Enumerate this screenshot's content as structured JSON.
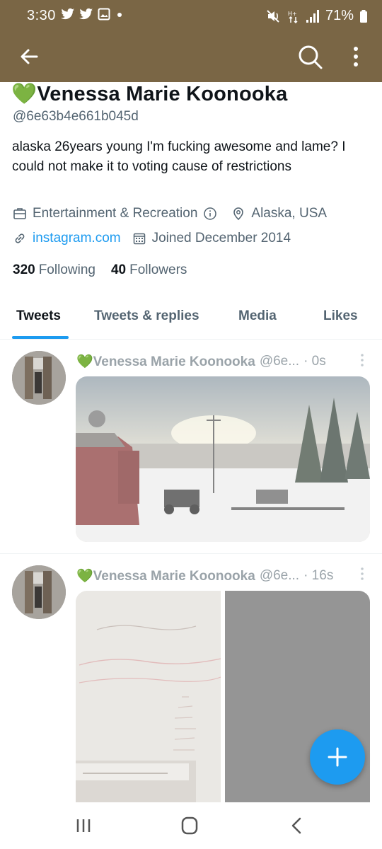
{
  "status_bar": {
    "time": "3:30",
    "battery": "71%",
    "icons_left": [
      "twitter-icon",
      "twitter-icon",
      "gallery-icon",
      "dot-icon"
    ],
    "icons_right": [
      "mute-icon",
      "data-arrows-icon",
      "signal-icon",
      "battery-icon"
    ]
  },
  "app_bar": {
    "icons": [
      "back-arrow-icon",
      "search-icon",
      "more-vertical-icon"
    ],
    "background": "#7a6645"
  },
  "profile": {
    "name_emoji": "💚",
    "name": "Venessa Marie Koonooka",
    "handle": "@6e63b4e661b045d",
    "bio": "alaska 26years young I'm fucking awesome and lame? I could not make it to voting cause of restrictions",
    "category": "Entertainment & Recreation",
    "location": "Alaska, USA",
    "website": "instagram.com",
    "joined": "Joined December 2014",
    "following_count": "320",
    "following_label": "Following",
    "followers_count": "40",
    "followers_label": "Followers"
  },
  "tabs": [
    {
      "label": "Tweets",
      "active": true
    },
    {
      "label": "Tweets & replies",
      "active": false
    },
    {
      "label": "Media",
      "active": false
    },
    {
      "label": "Likes",
      "active": false
    }
  ],
  "tweets": [
    {
      "name": "💚Venessa Marie Koonooka",
      "handle": "@6e...",
      "time": "· 0s",
      "media": "snowy-yard-photo"
    },
    {
      "name": "💚Venessa Marie Koonooka",
      "handle": "@6e...",
      "time": "· 16s",
      "media": "birthday-card-photo"
    }
  ],
  "accent_color": "#1d9bf0",
  "fab": {
    "icon": "plus-icon"
  },
  "nav_bar": {
    "icons": [
      "recents-icon",
      "home-icon",
      "back-icon"
    ]
  }
}
